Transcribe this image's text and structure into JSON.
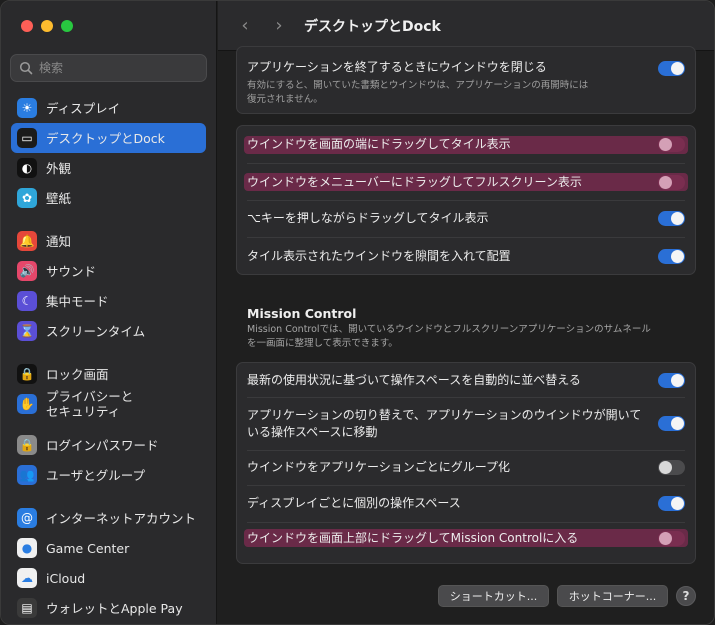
{
  "window": {
    "title": "デスクトップとDock"
  },
  "sidebar": {
    "search_placeholder": "検索",
    "items": [
      {
        "label": "ディスプレイ",
        "icon": "sun-icon",
        "color": "#2a7de1",
        "glyph": "☀"
      },
      {
        "label": "デスクトップとDock",
        "icon": "dock-icon",
        "color": "#1b1b1b",
        "glyph": "▭",
        "active": true
      },
      {
        "label": "外観",
        "icon": "appearance-icon",
        "color": "#111111",
        "glyph": "◐"
      },
      {
        "label": "壁紙",
        "icon": "wallpaper-icon",
        "color": "#2fa6d9",
        "glyph": "✿"
      },
      {
        "label": "通知",
        "icon": "bell-icon",
        "color": "#e5473a",
        "glyph": "🔔"
      },
      {
        "label": "サウンド",
        "icon": "speaker-icon",
        "color": "#e5476a",
        "glyph": "🔊"
      },
      {
        "label": "集中モード",
        "icon": "moon-icon",
        "color": "#5b4fd6",
        "glyph": "☾"
      },
      {
        "label": "スクリーンタイム",
        "icon": "hourglass-icon",
        "color": "#5b4fd6",
        "glyph": "⌛"
      },
      {
        "label": "ロック画面",
        "icon": "lock-icon",
        "color": "#111111",
        "glyph": "🔒"
      },
      {
        "label": "プライバシーと\nセキュリティ",
        "icon": "hand-icon",
        "color": "#2a6fd6",
        "glyph": "✋"
      },
      {
        "label": "ログインパスワード",
        "icon": "key-lock-icon",
        "color": "#8a8a8a",
        "glyph": "🔒"
      },
      {
        "label": "ユーザとグループ",
        "icon": "users-icon",
        "color": "#2a6fd6",
        "glyph": "👥"
      },
      {
        "label": "インターネットアカウント",
        "icon": "at-icon",
        "color": "#2a7de1",
        "glyph": "@"
      },
      {
        "label": "Game Center",
        "icon": "game-center-icon",
        "color": "#f0f0f0",
        "glyph": "●"
      },
      {
        "label": "iCloud",
        "icon": "cloud-icon",
        "color": "#f0f0f0",
        "glyph": "☁"
      },
      {
        "label": "ウォレットとApple Pay",
        "icon": "wallet-icon",
        "color": "#3a3a3a",
        "glyph": "▤"
      }
    ]
  },
  "group1": {
    "label": "アプリケーションを終了するときにウインドウを閉じる",
    "desc": "有効にすると、開いていた書類とウインドウは、アプリケーションの再開時には\n復元されません。",
    "on": true
  },
  "group2": {
    "rows": [
      {
        "label": "ウインドウを画面の端にドラッグしてタイル表示",
        "state": "off-highlight"
      },
      {
        "label": "ウインドウをメニューバーにドラッグしてフルスクリーン表示",
        "state": "off-highlight"
      },
      {
        "label": "⌥キーを押しながらドラッグしてタイル表示",
        "state": "on"
      },
      {
        "label": "タイル表示されたウインドウを隙間を入れて配置",
        "state": "on"
      }
    ]
  },
  "mission": {
    "title": "Mission Control",
    "desc": "Mission Controlでは、開いているウインドウとフルスクリーンアプリケーションのサムネール\nを一画面に整理して表示できます。",
    "rows": [
      {
        "label": "最新の使用状況に基づいて操作スペースを自動的に並べ替える",
        "state": "on"
      },
      {
        "label": "アプリケーションの切り替えで、アプリケーションのウインドウが開いて\nいる操作スペースに移動",
        "state": "on"
      },
      {
        "label": "ウインドウをアプリケーションごとにグループ化",
        "state": "off"
      },
      {
        "label": "ディスプレイごとに個別の操作スペース",
        "state": "on"
      },
      {
        "label": "ウインドウを画面上部にドラッグしてMission Controlに入る",
        "state": "off-highlight"
      }
    ]
  },
  "footer": {
    "shortcuts": "ショートカット...",
    "hot_corners": "ホットコーナー...",
    "help": "?"
  }
}
